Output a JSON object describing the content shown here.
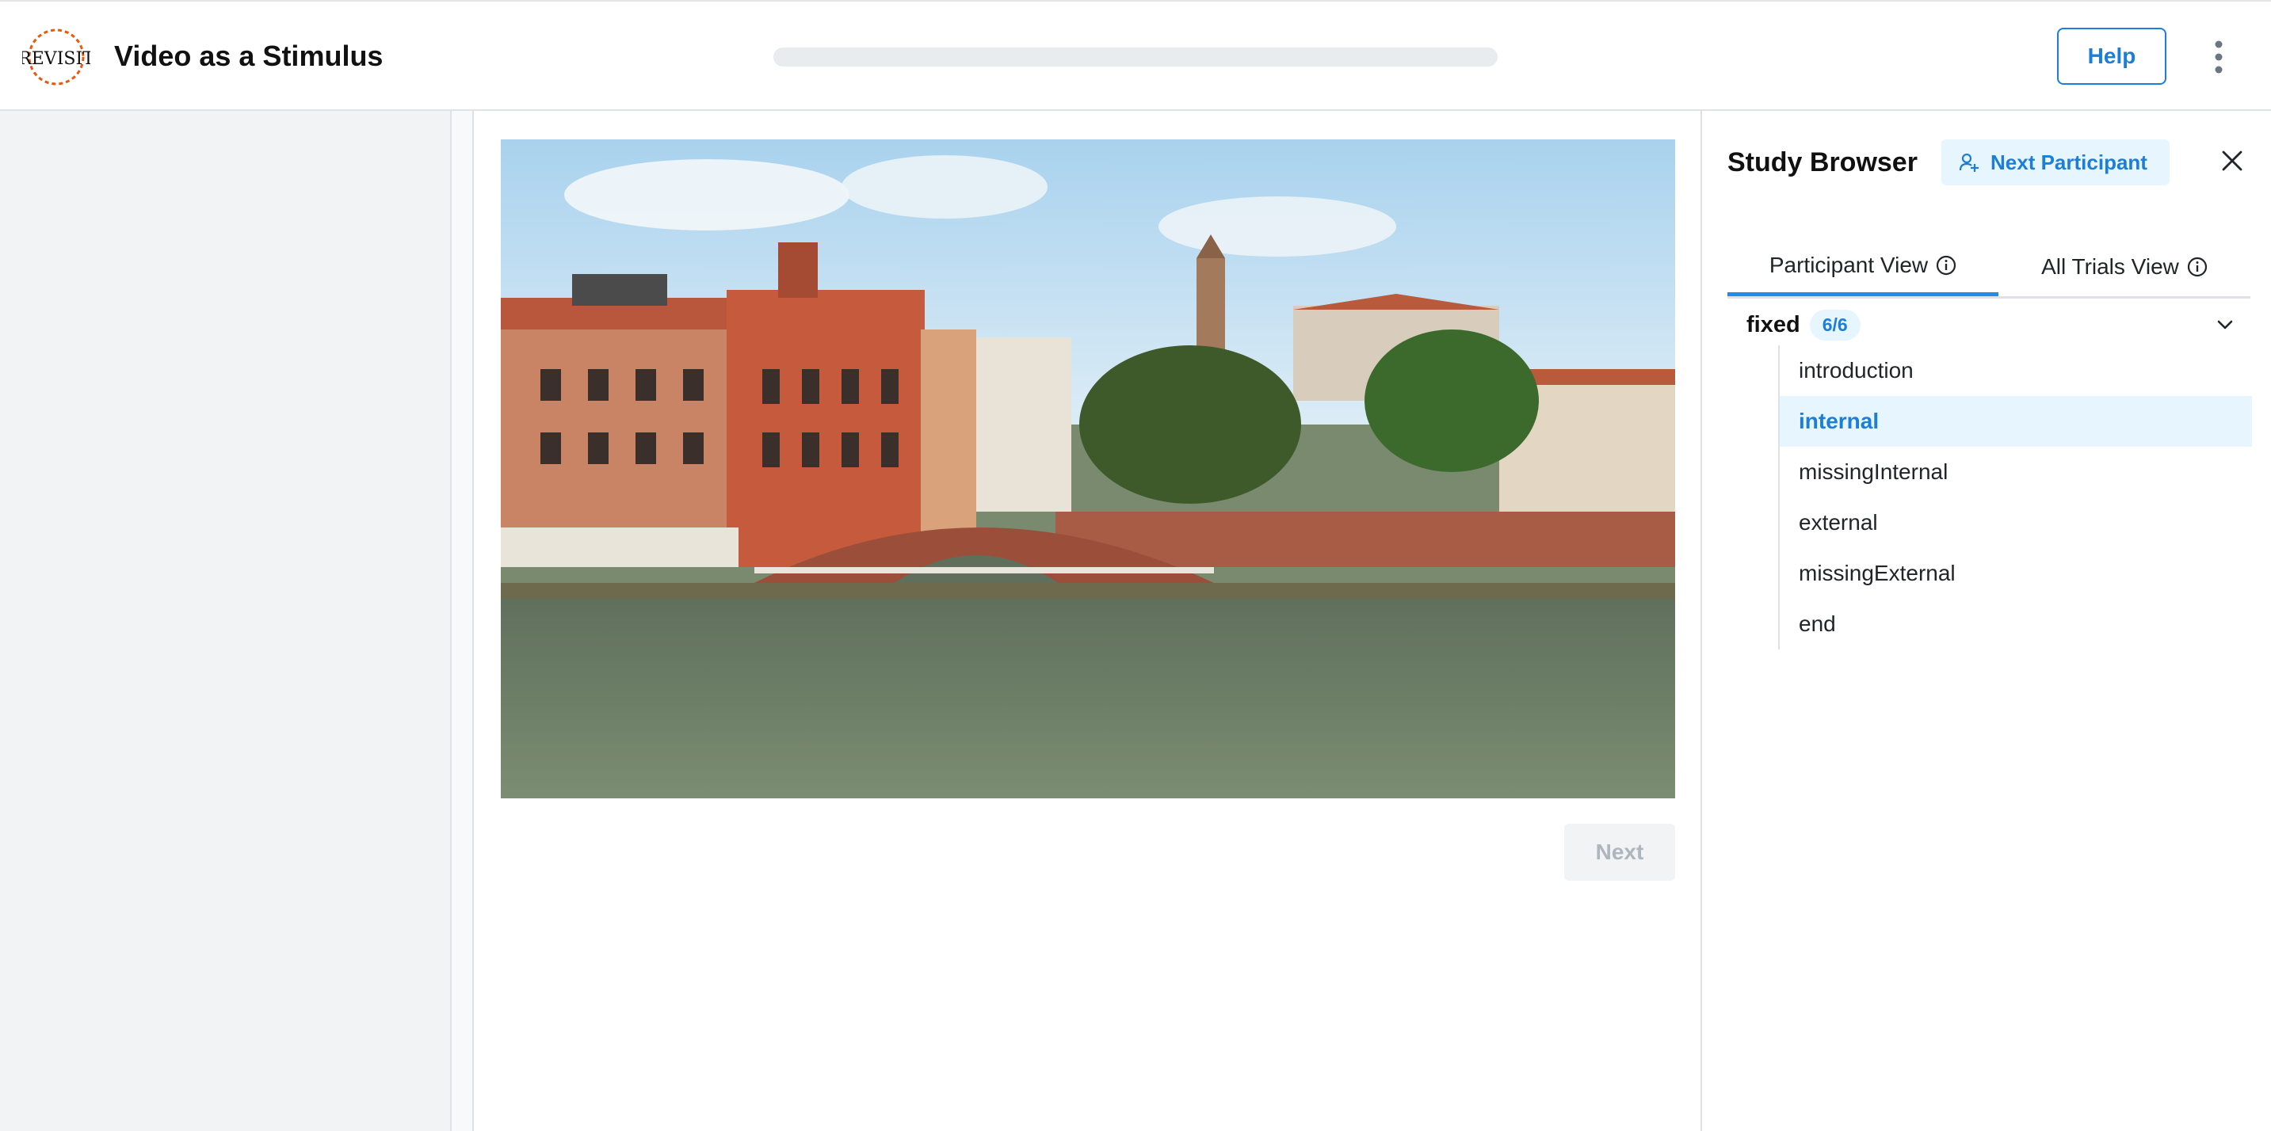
{
  "header": {
    "logo_text": "REVISIT",
    "title": "Video as a Stimulus",
    "progress_fraction": 0,
    "help_label": "Help"
  },
  "main": {
    "next_label": "Next"
  },
  "study_browser": {
    "title": "Study Browser",
    "next_participant_label": "Next Participant",
    "tabs": [
      {
        "label": "Participant View",
        "active": true
      },
      {
        "label": "All Trials View",
        "active": false
      }
    ],
    "group": {
      "label": "fixed",
      "badge": "6/6"
    },
    "trials": [
      {
        "label": "introduction",
        "selected": false
      },
      {
        "label": "internal",
        "selected": true
      },
      {
        "label": "missingInternal",
        "selected": false
      },
      {
        "label": "external",
        "selected": false
      },
      {
        "label": "missingExternal",
        "selected": false
      },
      {
        "label": "end",
        "selected": false
      }
    ]
  },
  "colors": {
    "accent": "#228be6",
    "accent_light": "#e7f5ff",
    "panel_gray": "#f1f3f5"
  },
  "icons": [
    "revisit-logo",
    "kebab-menu-icon",
    "user-plus-icon",
    "close-icon",
    "info-icon",
    "chevron-down-icon"
  ]
}
